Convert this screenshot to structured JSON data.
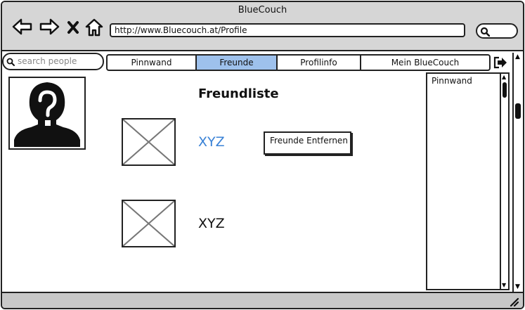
{
  "window": {
    "title": "BlueCouch"
  },
  "browser": {
    "url": "http://www.Bluecouch.at/Profile",
    "icons": [
      "back-arrow-icon",
      "forward-arrow-icon",
      "close-x-icon",
      "home-icon",
      "search-icon"
    ]
  },
  "search": {
    "placeholder": "search people"
  },
  "tabs": [
    {
      "label": "Pinnwand"
    },
    {
      "label": "Freunde",
      "active": true
    },
    {
      "label": "Profilinfo"
    },
    {
      "label": "Mein BlueCouch"
    }
  ],
  "main": {
    "heading": "Freundliste",
    "friends": [
      {
        "name": "XYZ",
        "link": true,
        "action": "Freunde Entfernen"
      },
      {
        "name": "XYZ",
        "link": false
      }
    ]
  },
  "side_panel": {
    "title": "Pinnwand"
  },
  "colors": {
    "active_tab": "#9ec1ec",
    "link": "#3a82d6",
    "chrome": "#d6d6d6"
  }
}
